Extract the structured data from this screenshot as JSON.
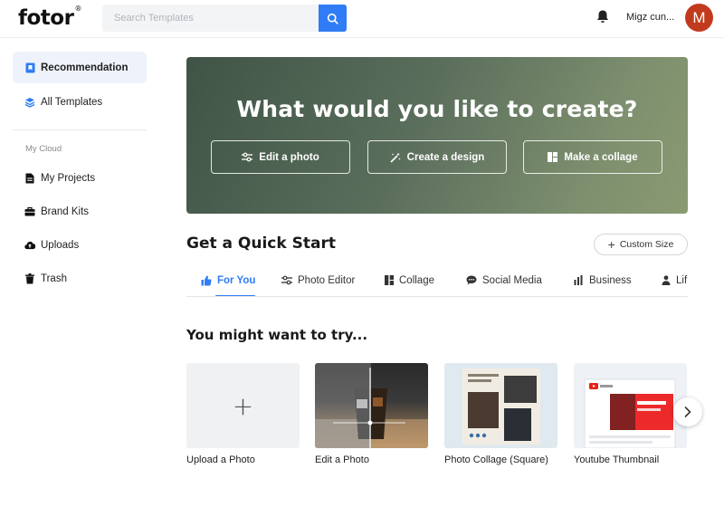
{
  "app": {
    "logo": "fotor",
    "logo_mark": "®"
  },
  "search": {
    "placeholder": "Search Templates"
  },
  "user": {
    "name": "Migz cun...",
    "avatar_initial": "M",
    "avatar_color": "#c23a1e"
  },
  "sidebar": {
    "items": [
      {
        "label": "Recommendation",
        "icon": "bookmark-icon",
        "active": true
      },
      {
        "label": "All Templates",
        "icon": "layers-icon",
        "active": false
      }
    ],
    "section_label": "My Cloud",
    "cloud_items": [
      {
        "label": "My Projects",
        "icon": "document-icon"
      },
      {
        "label": "Brand Kits",
        "icon": "briefcase-icon"
      },
      {
        "label": "Uploads",
        "icon": "cloud-upload-icon"
      },
      {
        "label": "Trash",
        "icon": "trash-icon"
      }
    ]
  },
  "hero": {
    "title": "What would you like to create?",
    "buttons": [
      {
        "label": "Edit a photo",
        "icon": "sliders-icon"
      },
      {
        "label": "Create a design",
        "icon": "magic-wand-icon"
      },
      {
        "label": "Make a collage",
        "icon": "collage-icon"
      }
    ]
  },
  "quick_start": {
    "title": "Get a Quick Start",
    "custom_size_label": "Custom Size",
    "tabs": [
      {
        "label": "For You",
        "icon": "thumbs-up-icon",
        "active": true
      },
      {
        "label": "Photo Editor",
        "icon": "sliders-icon"
      },
      {
        "label": "Collage",
        "icon": "collage-icon"
      },
      {
        "label": "Social Media",
        "icon": "chat-icon"
      },
      {
        "label": "Business",
        "icon": "bar-chart-icon"
      },
      {
        "label": "Lif",
        "icon": "person-icon"
      }
    ]
  },
  "suggestions": {
    "title": "You might want to try...",
    "cards": [
      {
        "label": "Upload a Photo"
      },
      {
        "label": "Edit a Photo"
      },
      {
        "label": "Photo Collage (Square)"
      },
      {
        "label": "Youtube Thumbnail"
      }
    ]
  },
  "colors": {
    "accent": "#2f7cf6",
    "hero_start": "#3f5446",
    "hero_end": "#8a9a72"
  }
}
